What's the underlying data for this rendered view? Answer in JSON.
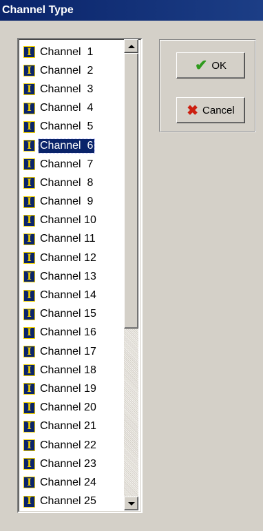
{
  "window": {
    "title": "Channel Type"
  },
  "list": {
    "selected": "Channel 6",
    "items": [
      "Channel  1",
      "Channel  2",
      "Channel  3",
      "Channel  4",
      "Channel  5",
      "Channel  6",
      "Channel  7",
      "Channel  8",
      "Channel  9",
      "Channel 10",
      "Channel 11",
      "Channel 12",
      "Channel 13",
      "Channel 14",
      "Channel 15",
      "Channel 16",
      "Channel 17",
      "Channel 18",
      "Channel 19",
      "Channel 20",
      "Channel 21",
      "Channel 22",
      "Channel 23",
      "Channel 24",
      "Channel 25"
    ],
    "item_icon": "I"
  },
  "buttons": {
    "ok_label": "OK",
    "ok_icon": "checkmark-icon",
    "cancel_label": "Cancel",
    "cancel_icon": "x-icon"
  },
  "colors": {
    "titlebar": "#0a246a",
    "selection": "#0a246a",
    "icon_bg": "#0a246a",
    "icon_fg": "#f0d000",
    "ok_glyph": "#2e9a1c",
    "cancel_glyph": "#cc1f10"
  }
}
